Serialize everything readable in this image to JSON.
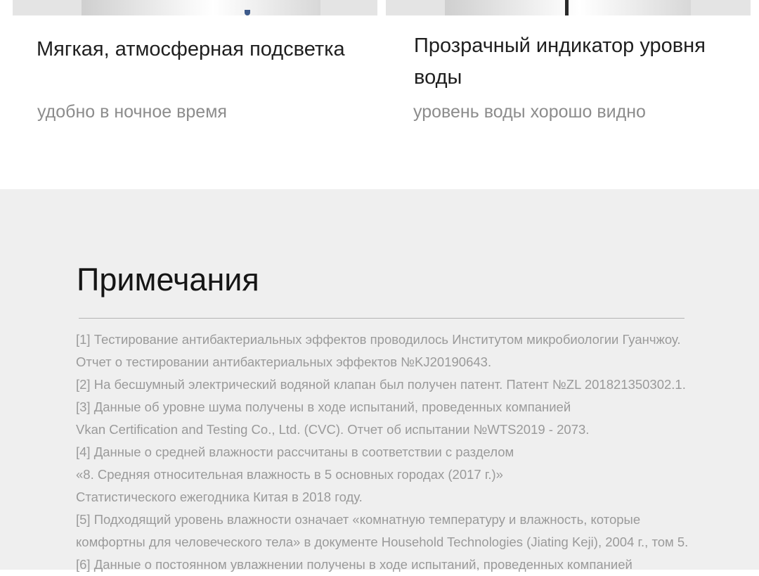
{
  "features": [
    {
      "title": "Мягкая, атмосферная подсветка",
      "subtitle": "удобно в ночное время"
    },
    {
      "title": "Прозрачный индикатор уровня воды",
      "subtitle": "уровень воды хорошо видно"
    }
  ],
  "notes": {
    "title": "Примечания",
    "lines": [
      "[1] Тестирование антибактериальных эффектов проводилось Институтом микробиологии Гуанчжоу.",
      "Отчет о тестировании антибактериальных эффектов №KJ20190643.",
      "[2] На бесшумный электрический водяной клапан был получен патент. Патент №ZL 201821350302.1.",
      "[3] Данные об уровне шума получены в ходе испытаний, проведенных компанией",
      "Vkan Certification and Testing Co., Ltd. (CVC). Отчет об испытании №WTS2019 - 2073.",
      "[4] Данные о средней влажности рассчитаны в соответствии с разделом",
      "«8. Средняя относительная влажность в 5 основных городах (2017 г.)»",
      "Статистического ежегодника Китая в 2018 году.",
      "[5] Подходящий уровень влажности означает «комнатную температуру и влажность, которые",
      "комфортны для человеческого тела» в документе Household Technologies (Jiating Keji), 2004 г., том 5.",
      "[6] Данные о постоянном увлажнении получены в ходе испытаний, проведенных компанией"
    ]
  }
}
